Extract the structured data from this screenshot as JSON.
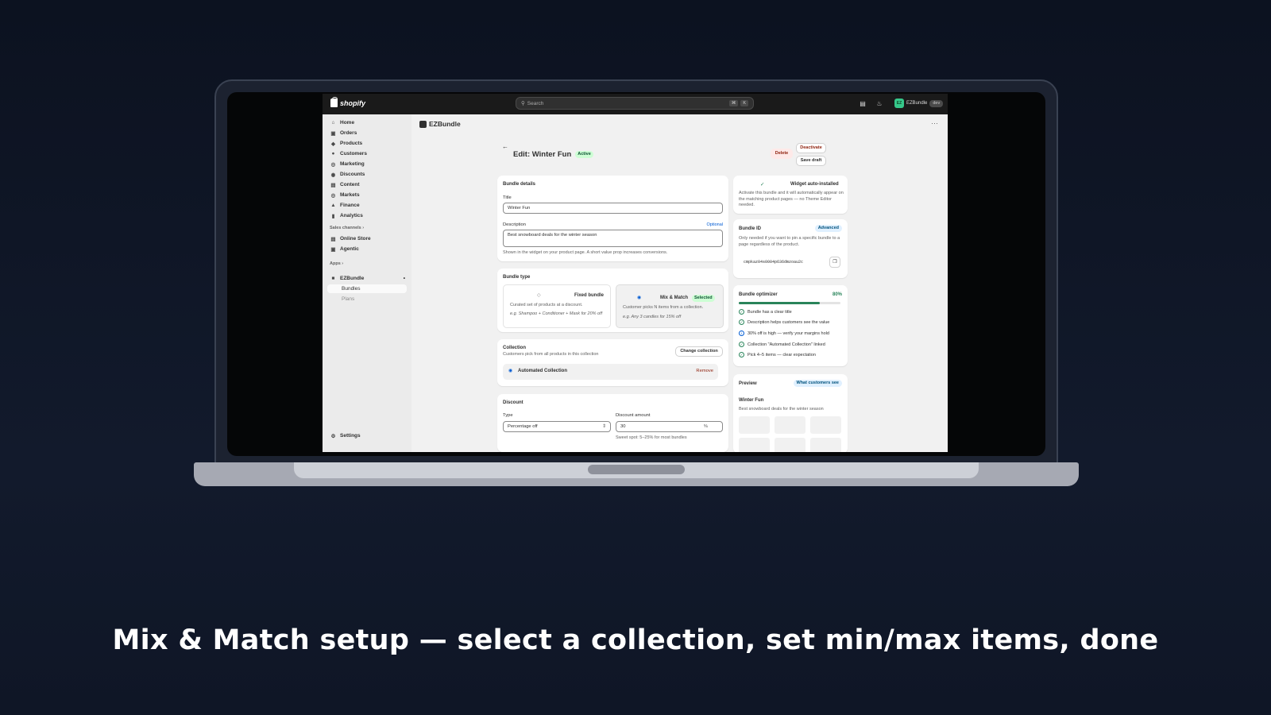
{
  "caption": "Mix & Match setup — select a collection, set min/max items, done",
  "topbar": {
    "brand": "shopify",
    "search_placeholder": "Search",
    "shortcut_keys": [
      "⌘",
      "K"
    ],
    "store_initials": "EZ",
    "store_name": "EZBundle",
    "store_tag": "dev"
  },
  "sidebar": {
    "items": [
      {
        "label": "Home",
        "icon": "home-icon"
      },
      {
        "label": "Orders",
        "icon": "orders-icon"
      },
      {
        "label": "Products",
        "icon": "tag-icon"
      },
      {
        "label": "Customers",
        "icon": "person-icon"
      },
      {
        "label": "Marketing",
        "icon": "target-icon"
      },
      {
        "label": "Discounts",
        "icon": "discount-icon"
      },
      {
        "label": "Content",
        "icon": "content-icon"
      },
      {
        "label": "Markets",
        "icon": "globe-icon"
      },
      {
        "label": "Finance",
        "icon": "bank-icon"
      },
      {
        "label": "Analytics",
        "icon": "chart-icon"
      }
    ],
    "sales_channels_label": "Sales channels",
    "channels": [
      "Online Store",
      "Agentic"
    ],
    "apps_label": "Apps",
    "app_name": "EZBundle",
    "app_subitems": [
      "Bundles",
      "Plans"
    ],
    "settings_label": "Settings"
  },
  "main": {
    "app_title": "EZBundle",
    "page_title": "Edit: Winter Fun",
    "status_badge": "Active",
    "delete_label": "Delete",
    "deactivate_label": "Deactivate",
    "save_draft_label": "Save draft"
  },
  "bundle_details": {
    "heading": "Bundle details",
    "title_label": "Title",
    "title_value": "Winter Fun",
    "description_label": "Description",
    "optional_label": "Optional",
    "description_value": "Best snowboard deals for the winter season",
    "help_text": "Shown in the widget on your product page. A short value prop increases conversions."
  },
  "bundle_type": {
    "heading": "Bundle type",
    "fixed": {
      "title": "Fixed bundle",
      "desc": "Curated set of products at a discount.",
      "example": "e.g. Shampoo + Conditioner + Mask for 20% off"
    },
    "mix": {
      "title": "Mix & Match",
      "badge": "Selected",
      "desc": "Customer picks N items from a collection.",
      "example": "e.g. Any 3 candles for 15% off"
    }
  },
  "collection": {
    "heading": "Collection",
    "subtitle": "Customers pick from all products in this collection",
    "change_label": "Change collection",
    "name": "Automated Collection",
    "remove_label": "Remove"
  },
  "discount": {
    "heading": "Discount",
    "type_label": "Type",
    "type_value": "Percentage off",
    "amount_label": "Discount amount",
    "amount_value": "30",
    "amount_suffix": "%",
    "hint": "Sweet spot: 5–25% for most bundles"
  },
  "widget": {
    "title": "Widget auto-installed",
    "desc": "Activate this bundle and it will automatically appear on the matching product pages — no Theme Editor needed."
  },
  "bundle_id": {
    "title": "Bundle ID",
    "badge": "Advanced",
    "desc": "Only needed if you want to pin a specific bundle to a page regardless of the product.",
    "value": "cmpkaz04s0004p636dmzoau2c"
  },
  "optimizer": {
    "title": "Bundle optimizer",
    "score_label": "80%",
    "score": 0.8,
    "checks": [
      {
        "text": "Bundle has a clear title",
        "status": "ok"
      },
      {
        "text": "Description helps customers see the value",
        "status": "ok"
      },
      {
        "text": "30% off is high — verify your margins hold",
        "status": "info"
      },
      {
        "text": "Collection \"Automated Collection\" linked",
        "status": "ok"
      },
      {
        "text": "Pick 4–5 items — clear expectation",
        "status": "ok"
      }
    ]
  },
  "preview": {
    "title": "Preview",
    "badge": "What customers see",
    "bundle_title": "Winter Fun",
    "bundle_desc": "Best snowboard deals for the winter season"
  }
}
